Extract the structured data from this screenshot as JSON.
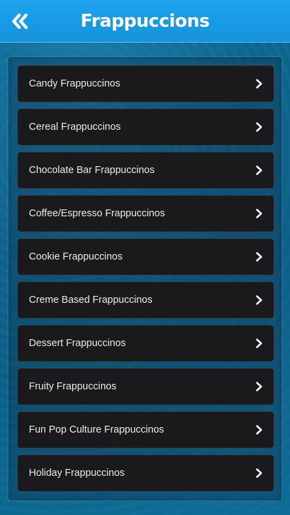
{
  "header": {
    "title": "Frappuccions",
    "back_icon": "double-chevron-left-icon"
  },
  "colors": {
    "header_bg": "#1592dc",
    "page_bg": "#0b5d84",
    "item_bg": "#1a1a1c",
    "item_text": "#ececec"
  },
  "list": {
    "items": [
      {
        "label": "Candy Frappuccinos"
      },
      {
        "label": "Cereal Frappuccinos"
      },
      {
        "label": "Chocolate Bar Frappuccinos"
      },
      {
        "label": "Coffee/Espresso Frappuccinos"
      },
      {
        "label": "Cookie Frappuccinos"
      },
      {
        "label": "Creme Based Frappuccinos"
      },
      {
        "label": "Dessert Frappuccinos"
      },
      {
        "label": "Fruity Frappuccinos"
      },
      {
        "label": "Fun Pop Culture Frappuccinos"
      },
      {
        "label": "Holiday Frappuccinos"
      }
    ],
    "item_icon": "chevron-right-icon"
  }
}
